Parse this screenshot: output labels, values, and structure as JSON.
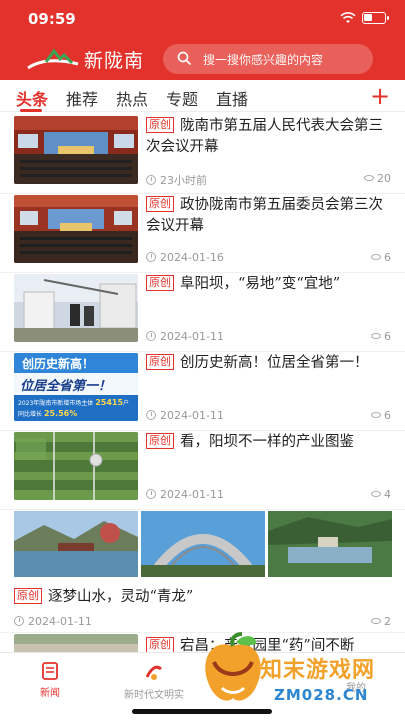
{
  "status": {
    "time": "09:59"
  },
  "header": {
    "logo_text": "新陇南",
    "search_placeholder": "搜一搜你感兴趣的内容"
  },
  "tabs": [
    {
      "label": "头条",
      "active": true
    },
    {
      "label": "推荐",
      "active": false
    },
    {
      "label": "热点",
      "active": false
    },
    {
      "label": "专题",
      "active": false
    },
    {
      "label": "直播",
      "active": false
    }
  ],
  "add_label": "+",
  "news": [
    {
      "badge": "原创",
      "title": "陇南市第五届人民代表大会第三次会议开幕",
      "date": "23小时前",
      "views": "20"
    },
    {
      "badge": "原创",
      "title": "政协陇南市第五届委员会第三次会议开幕",
      "date": "2024-01-16",
      "views": "6"
    },
    {
      "badge": "原创",
      "title": "阜阳坝，“易地”变“宜地”",
      "date": "2024-01-11",
      "views": "6"
    },
    {
      "badge": "原创",
      "title": "创历史新高！位居全省第一！",
      "date": "2024-01-11",
      "views": "6",
      "thumb_text": {
        "line1": "创历史新高！",
        "line2": "位居全省第一！",
        "line3": "2023年陇南市新增市场主体",
        "num": "25415",
        "unit": "户",
        "line4": "同比增长",
        "num2": "25.56%"
      }
    },
    {
      "badge": "原创",
      "title": "看，阳坝不一样的产业图鉴",
      "date": "2024-01-11",
      "views": "4"
    },
    {
      "badge": "原创",
      "title": "逐梦山水，灵动“青龙”",
      "date": "2024-01-11",
      "views": "2"
    },
    {
      "badge": "原创",
      "title": "宕昌：产业园里“药”间不断",
      "date": "",
      "views": ""
    }
  ],
  "bottom_nav": [
    {
      "label": "新闻",
      "active": true
    },
    {
      "label": "新时代文明实",
      "active": false
    },
    {
      "label": "我的",
      "active": false
    }
  ],
  "watermark": {
    "line1": "知末游戏网",
    "line2": "ZM028.CN"
  },
  "colors": {
    "brand_red": "#e3322c",
    "meta_gray": "#999999"
  }
}
